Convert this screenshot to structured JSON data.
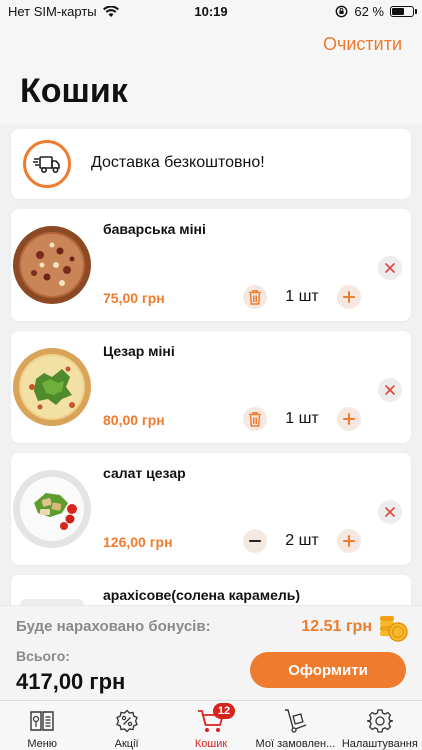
{
  "status_bar": {
    "carrier": "Нет SIM-карты",
    "time": "10:19",
    "battery": "62 %",
    "battery_level": 0.62
  },
  "header": {
    "clear_label": "Очистити",
    "title": "Кошик"
  },
  "delivery": {
    "text": "Доставка безкоштовно!"
  },
  "items": [
    {
      "name": "баварська міні",
      "price": "75,00 грн",
      "qty": "1 шт",
      "left_action": "trash"
    },
    {
      "name": "Цезар міні",
      "price": "80,00 грн",
      "qty": "1 шт",
      "left_action": "trash"
    },
    {
      "name": "салат цезар",
      "price": "126,00 грн",
      "qty": "2 шт",
      "left_action": "minus"
    },
    {
      "name": "арахісове(солена карамель)"
    }
  ],
  "summary": {
    "bonus_label": "Буде нараховано бонусів:",
    "bonus_value": "12.51 грн",
    "total_label": "Всього:",
    "total_value": "417,00 грн",
    "checkout_label": "Оформити"
  },
  "tabs": [
    {
      "label": "Меню",
      "icon": "menu-book-icon"
    },
    {
      "label": "Акції",
      "icon": "percent-badge-icon"
    },
    {
      "label": "Кошик",
      "icon": "cart-icon",
      "badge": "12",
      "active": true
    },
    {
      "label": "Мої замовлен...",
      "icon": "hand-truck-icon"
    },
    {
      "label": "Налаштування",
      "icon": "gear-icon"
    }
  ],
  "colors": {
    "accent": "#ef7b2f",
    "active_tab": "#d8241f",
    "background": "#f1f1f1"
  }
}
